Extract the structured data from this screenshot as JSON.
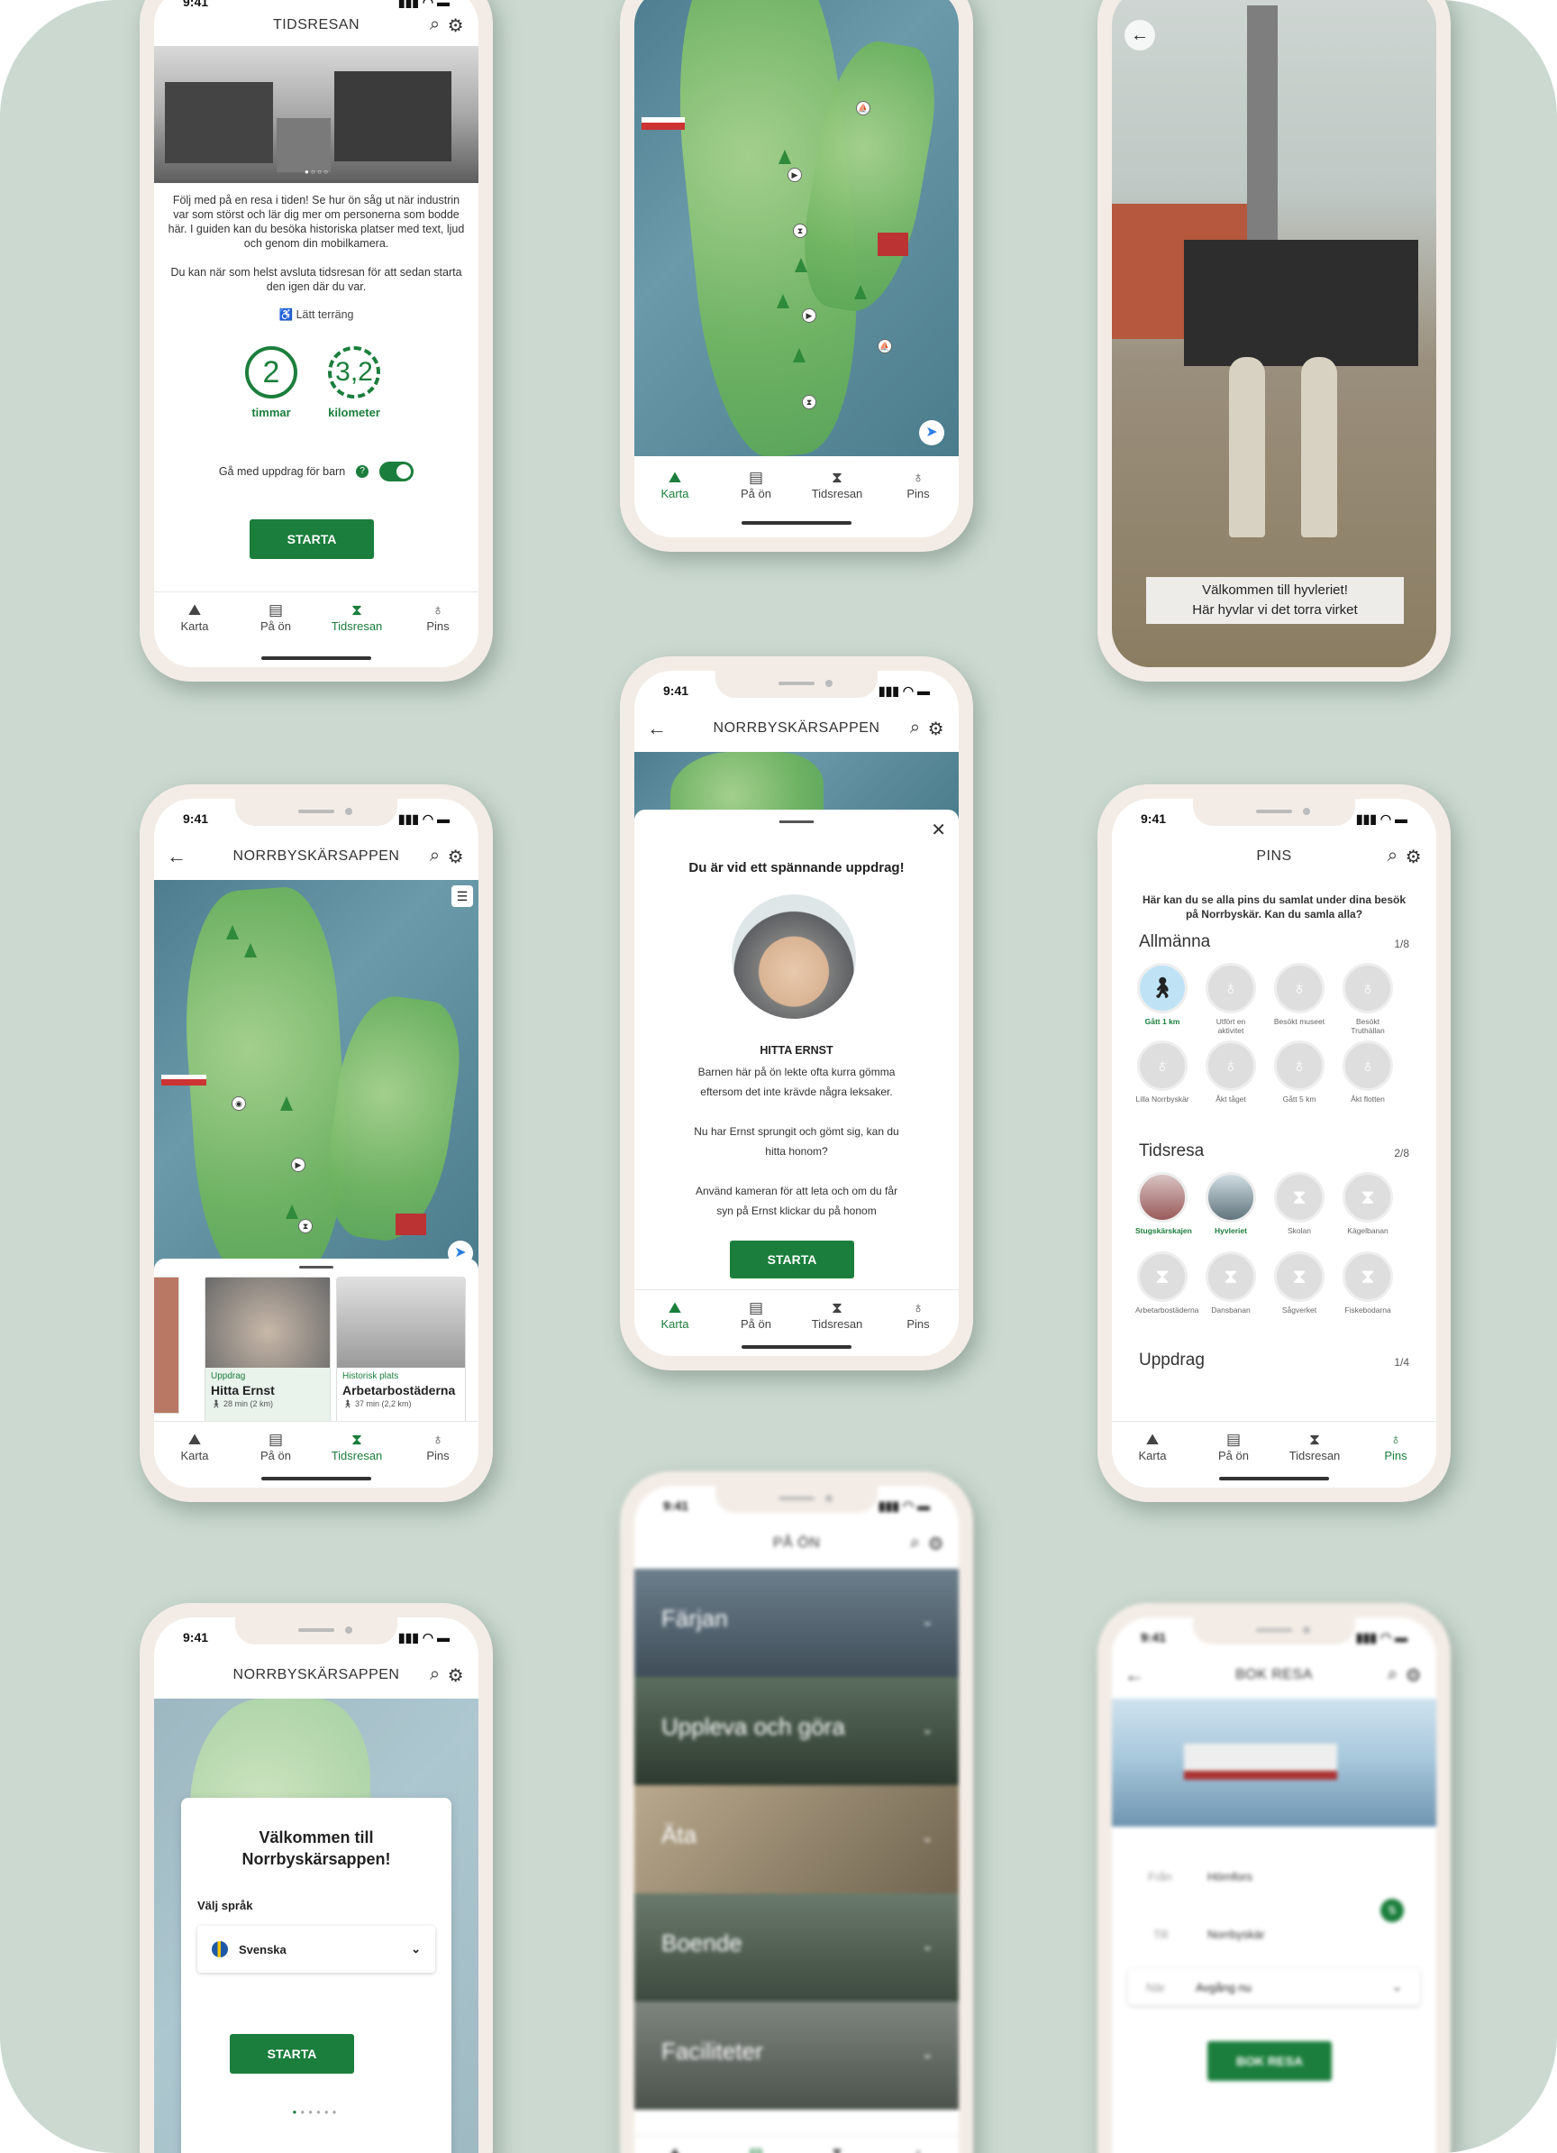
{
  "status_time": "9:41",
  "tabs": {
    "karta": "Karta",
    "paon": "På ön",
    "tidsresan": "Tidsresan",
    "pins": "Pins"
  },
  "icons": {
    "karta": "map-pin-icon",
    "paon": "list-icon",
    "tidsresan": "hourglass-icon",
    "pins": "award-icon",
    "search": "search-icon",
    "settings": "gear-icon",
    "back": "back-arrow-icon"
  },
  "colors": {
    "brand_green": "#1b7e3c",
    "phone_frame": "#f3ece6",
    "background": "#cbd9d0"
  },
  "tidsresan": {
    "title": "TIDSRESAN",
    "intro": "Följ med på en resa i tiden! Se hur ön såg ut när industrin var som störst och lär dig mer om personerna som bodde här. I guiden kan du besöka historiska platser med text, ljud och genom din mobilkamera.",
    "note": "Du kan när som helst avsluta tidsresan för att sedan starta den igen där du var.",
    "terrain": "Lätt terräng",
    "hours_value": "2",
    "hours_label": "timmar",
    "km_value": "3,2",
    "km_label": "kilometer",
    "kids_toggle": "Gå med uppdrag för barn",
    "kids_toggle_on": true,
    "start": "STARTA"
  },
  "hyvleriet": {
    "caption_line1": "Välkommen till hyvleriet!",
    "caption_line2": "Här hyvlar vi det torra virket"
  },
  "norrbyskar_map": {
    "title": "NORRBYSKÄRSAPPEN",
    "cards": [
      {
        "category": "Uppdrag",
        "name": "Hitta Ernst",
        "meta": "28 min (2 km)"
      },
      {
        "category": "Historisk plats",
        "name": "Arbetarbostäderna",
        "meta": "37 min (2,2 km)"
      }
    ]
  },
  "mission": {
    "title": "NORRBYSKÄRSAPPEN",
    "heading": "Du är vid ett spännande uppdrag!",
    "subtitle": "HITTA ERNST",
    "body1": "Barnen här på ön lekte ofta kurra gömma eftersom det inte krävde några leksaker.",
    "body2": "Nu har Ernst sprungit och gömt sig, kan du hitta honom?",
    "body3": "Använd kameran för att leta och om du får syn på Ernst klickar du på honom",
    "start": "STARTA"
  },
  "pins": {
    "title": "PINS",
    "intro": "Här kan du se alla pins du samlat under dina besök på Norrbyskär. Kan du samla alla?",
    "sections": [
      {
        "name": "Allmänna",
        "count": "1/8",
        "items": [
          "Gått 1 km",
          "Utfört en aktivitet",
          "Besökt museet",
          "Besökt Truthällan",
          "Lilla Norrbyskär",
          "Åkt tåget",
          "Gått 5 km",
          "Åkt flotten"
        ],
        "earned": [
          true,
          false,
          false,
          false,
          false,
          false,
          false,
          false
        ]
      },
      {
        "name": "Tidsresa",
        "count": "2/8",
        "items": [
          "Stugskärskajen",
          "Hyvleriet",
          "Skolan",
          "Kägelbanan",
          "Arbetarbostäderna",
          "Dansbanan",
          "Sågverket",
          "Fiskebodarna"
        ],
        "earned": [
          true,
          true,
          false,
          false,
          false,
          false,
          false,
          false
        ]
      },
      {
        "name": "Uppdrag",
        "count": "1/4"
      }
    ]
  },
  "welcome": {
    "title": "NORRBYSKÄRSAPPEN",
    "heading": "Välkommen till Norrbyskärsappen!",
    "lang_label": "Välj språk",
    "lang_value": "Svenska",
    "start": "STARTA"
  },
  "paon": {
    "title": "PÅ ÖN",
    "categories": [
      "Färjan",
      "Uppleva och göra",
      "Äta",
      "Boende",
      "Faciliteter"
    ]
  },
  "bokresa": {
    "title": "BOK RESA",
    "from_label": "Från",
    "from_value": "Hörnfors",
    "to_label": "Till",
    "to_value": "Norrbyskär",
    "when_label": "När",
    "when_value": "Avgång nu",
    "button": "BOK RESA"
  }
}
